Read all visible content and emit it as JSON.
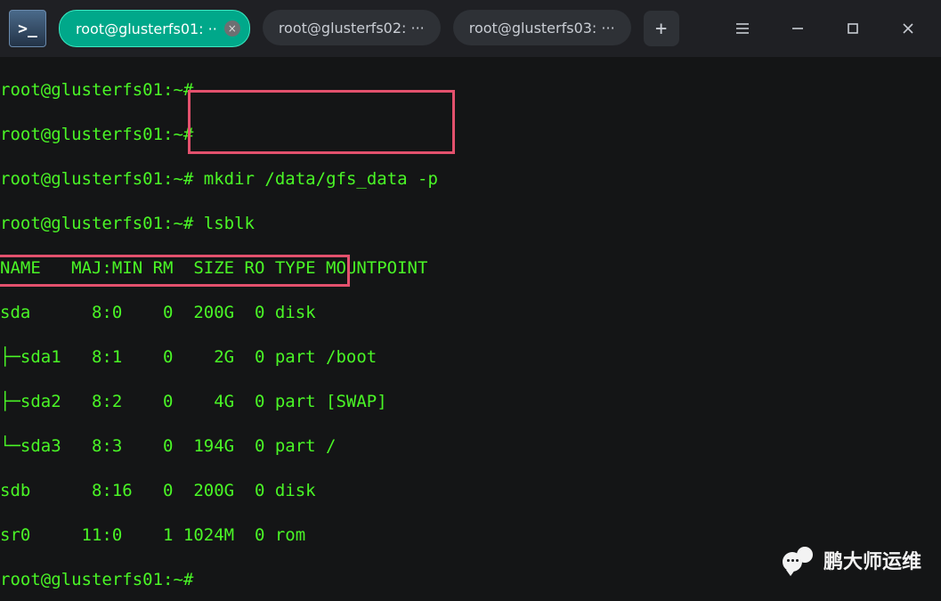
{
  "app_icon_glyph": ">_",
  "tabs": [
    {
      "label": "root@glusterfs01: ··",
      "active": true,
      "closable": true
    },
    {
      "label": "root@glusterfs02: ···",
      "active": false,
      "closable": false
    },
    {
      "label": "root@glusterfs03: ···",
      "active": false,
      "closable": false
    }
  ],
  "new_tab_label": "+",
  "prompt": "root@glusterfs01:~#",
  "commands": {
    "blank1": "",
    "blank2": "",
    "mkdir": "mkdir /data/gfs_data -p",
    "lsblk": "lsblk",
    "blank3": ""
  },
  "lsblk_header": "NAME   MAJ:MIN RM  SIZE RO TYPE MOUNTPOINT",
  "lsblk_rows": [
    "sda      8:0    0  200G  0 disk ",
    "├─sda1   8:1    0    2G  0 part /boot",
    "├─sda2   8:2    0    4G  0 part [SWAP]",
    "└─sda3   8:3    0  194G  0 part /",
    "sdb      8:16   0  200G  0 disk ",
    "sr0     11:0    1 1024M  0 rom  "
  ],
  "watermark_text": "鹏大师运维"
}
